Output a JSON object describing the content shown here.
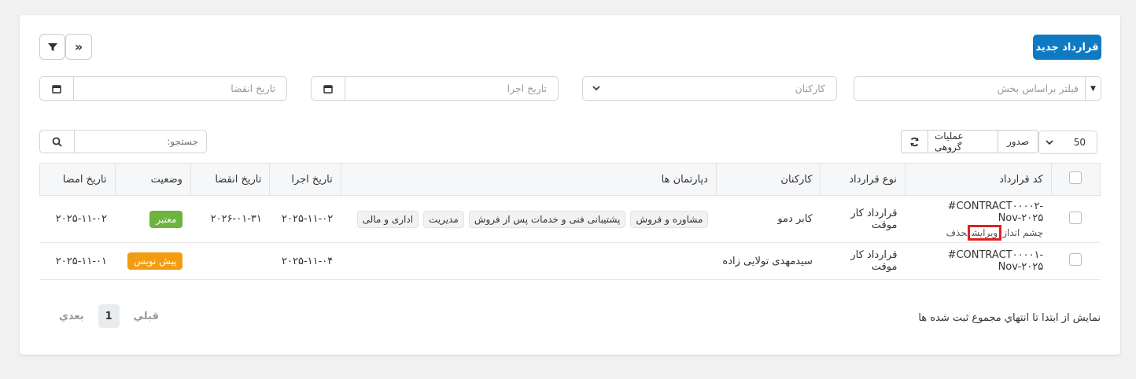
{
  "toolbar": {
    "new_contract_label": "قرارداد جدید"
  },
  "filters": {
    "department_placeholder": "فیلتر براساس بخش",
    "employee_placeholder": "کارکنان",
    "start_date_placeholder": "تاریخ اجرا",
    "end_date_placeholder": "تاریخ انقضا"
  },
  "controls": {
    "page_size": "50",
    "export_label": "صدور",
    "bulk_label": "عملیات گروهی",
    "search_placeholder": "جستجو:"
  },
  "table": {
    "headers": {
      "code": "کد قرارداد",
      "type": "نوع قرارداد",
      "employee": "کارکنان",
      "departments": "دپارتمان ها",
      "start": "تاریخ اجرا",
      "end": "تاریخ انقضا",
      "status": "وضعیت",
      "signed": "تاریخ امضا"
    },
    "rows": [
      {
        "code": "#CONTRACT۰۰۰۰۲-Nov-۲۰۲۵",
        "action_view": "چشم انداز",
        "action_edit": "ویرایش",
        "action_delete": "حذف",
        "type": "قرارداد کار موقت",
        "employee": "کابر دمو",
        "departments": [
          "مشاوره و فروش",
          "پشتیبانی فنی و خدمات پس از فروش",
          "مدیریت",
          "اداری و مالی"
        ],
        "start": "۲۰۲۵-۱۱-۰۲",
        "end": "۲۰۲۶-۰۱-۳۱",
        "status": "معتبر",
        "signed": "۲۰۲۵-۱۱-۰۲"
      },
      {
        "code": "#CONTRACT۰۰۰۰۱-Nov-۲۰۲۵",
        "type": "قرارداد کار موقت",
        "employee": "سیدمهدی تولایی زاده",
        "start": "۲۰۲۵-۱۱-۰۴",
        "end": "",
        "status": "پیش نویس",
        "signed": "۲۰۲۵-۱۱-۰۱"
      }
    ]
  },
  "footer": {
    "info": "نمایش از ابتدا تا انتهاي مجموع ثبت شده ها",
    "prev": "قبلي",
    "current_page": "1",
    "next": "بعدي"
  },
  "colors": {
    "primary": "#0e7ac4",
    "valid": "#6cb33f",
    "draft": "#f39c12"
  }
}
